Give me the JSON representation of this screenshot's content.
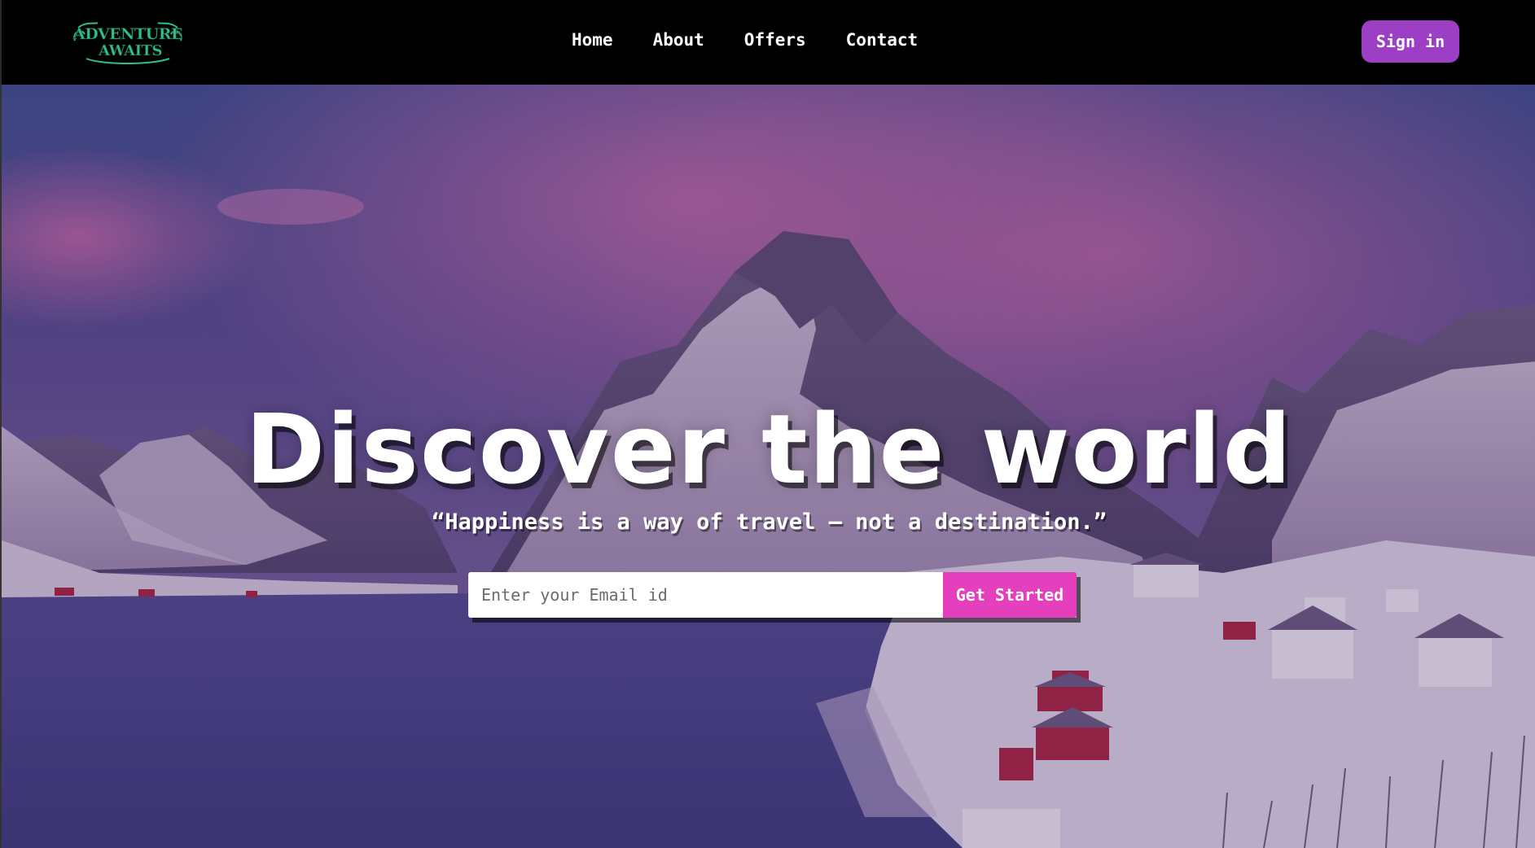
{
  "navbar": {
    "logo_text": [
      "ADVENTURE",
      "AWAITS"
    ],
    "links": [
      {
        "label": "Home"
      },
      {
        "label": "About"
      },
      {
        "label": "Offers"
      },
      {
        "label": "Contact"
      }
    ],
    "signin_label": "Sign in"
  },
  "hero": {
    "title": "Discover the world",
    "quote": "“Happiness is a way of travel – not a destination.”",
    "email_placeholder": "Enter your Email id",
    "email_value": "",
    "cta_label": "Get Started",
    "background": "snowy mountain fjord village at dusk"
  },
  "colors": {
    "navbar_bg": "#000000",
    "signin_bg": "#9c3fc4",
    "cta_bg": "#e43fbd",
    "logo": "#2fbf8a",
    "text": "#ffffff"
  }
}
